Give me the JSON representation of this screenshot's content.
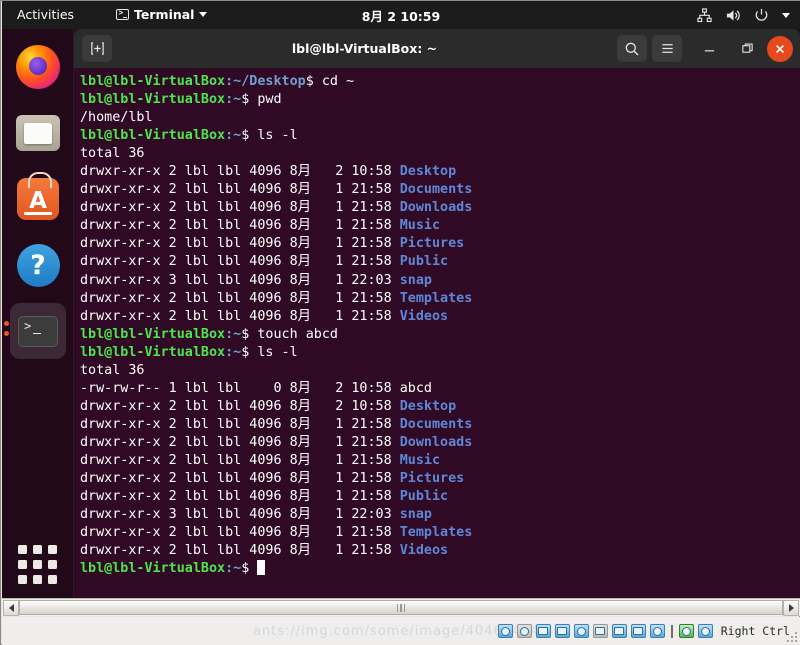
{
  "top_bar": {
    "activities": "Activities",
    "app_name": "Terminal",
    "clock": "8月 2 10:59",
    "icons": [
      "network-icon",
      "volume-icon",
      "power-icon",
      "chevron-down-icon"
    ]
  },
  "dock": {
    "items": [
      {
        "name": "firefox",
        "label": "Firefox"
      },
      {
        "name": "files",
        "label": "Files"
      },
      {
        "name": "ubuntu-software",
        "label": "Ubuntu Software",
        "glyph": "A"
      },
      {
        "name": "help",
        "label": "Help",
        "glyph": "?"
      },
      {
        "name": "terminal",
        "label": "Terminal",
        "running": true
      }
    ],
    "show_applications": "Show Applications"
  },
  "terminal": {
    "title": "lbl@lbl-VirtualBox: ~",
    "new_tab_label": "+",
    "search_label": "Search",
    "menu_label": "Menu",
    "minimize_label": "Minimize",
    "maximize_label": "Restore",
    "close_label": "Close",
    "prompt_user": "lbl@lbl-VirtualBox",
    "lines": [
      {
        "type": "prompt",
        "host": "lbl@lbl-VirtualBox",
        "path": ":~/Desktop",
        "sym": "$ ",
        "cmd": "cd ~"
      },
      {
        "type": "prompt",
        "host": "lbl@lbl-VirtualBox",
        "path": ":~",
        "sym": "$ ",
        "cmd": "pwd"
      },
      {
        "type": "out",
        "text": "/home/lbl"
      },
      {
        "type": "prompt",
        "host": "lbl@lbl-VirtualBox",
        "path": ":~",
        "sym": "$ ",
        "cmd": "ls -l"
      },
      {
        "type": "out",
        "text": "total 36"
      },
      {
        "type": "ls",
        "perm": "drwxr-xr-x",
        "links": "2",
        "owner": "lbl",
        "group": "lbl",
        "size": "4096",
        "month": "8月",
        "day": "2",
        "time": "10:58",
        "name": "Desktop",
        "dir": true
      },
      {
        "type": "ls",
        "perm": "drwxr-xr-x",
        "links": "2",
        "owner": "lbl",
        "group": "lbl",
        "size": "4096",
        "month": "8月",
        "day": "1",
        "time": "21:58",
        "name": "Documents",
        "dir": true
      },
      {
        "type": "ls",
        "perm": "drwxr-xr-x",
        "links": "2",
        "owner": "lbl",
        "group": "lbl",
        "size": "4096",
        "month": "8月",
        "day": "1",
        "time": "21:58",
        "name": "Downloads",
        "dir": true
      },
      {
        "type": "ls",
        "perm": "drwxr-xr-x",
        "links": "2",
        "owner": "lbl",
        "group": "lbl",
        "size": "4096",
        "month": "8月",
        "day": "1",
        "time": "21:58",
        "name": "Music",
        "dir": true
      },
      {
        "type": "ls",
        "perm": "drwxr-xr-x",
        "links": "2",
        "owner": "lbl",
        "group": "lbl",
        "size": "4096",
        "month": "8月",
        "day": "1",
        "time": "21:58",
        "name": "Pictures",
        "dir": true
      },
      {
        "type": "ls",
        "perm": "drwxr-xr-x",
        "links": "2",
        "owner": "lbl",
        "group": "lbl",
        "size": "4096",
        "month": "8月",
        "day": "1",
        "time": "21:58",
        "name": "Public",
        "dir": true
      },
      {
        "type": "ls",
        "perm": "drwxr-xr-x",
        "links": "3",
        "owner": "lbl",
        "group": "lbl",
        "size": "4096",
        "month": "8月",
        "day": "1",
        "time": "22:03",
        "name": "snap",
        "dir": true
      },
      {
        "type": "ls",
        "perm": "drwxr-xr-x",
        "links": "2",
        "owner": "lbl",
        "group": "lbl",
        "size": "4096",
        "month": "8月",
        "day": "1",
        "time": "21:58",
        "name": "Templates",
        "dir": true
      },
      {
        "type": "ls",
        "perm": "drwxr-xr-x",
        "links": "2",
        "owner": "lbl",
        "group": "lbl",
        "size": "4096",
        "month": "8月",
        "day": "1",
        "time": "21:58",
        "name": "Videos",
        "dir": true
      },
      {
        "type": "prompt",
        "host": "lbl@lbl-VirtualBox",
        "path": ":~",
        "sym": "$ ",
        "cmd": "touch abcd"
      },
      {
        "type": "prompt",
        "host": "lbl@lbl-VirtualBox",
        "path": ":~",
        "sym": "$ ",
        "cmd": "ls -l"
      },
      {
        "type": "out",
        "text": "total 36"
      },
      {
        "type": "ls",
        "perm": "-rw-rw-r--",
        "links": "1",
        "owner": "lbl",
        "group": "lbl",
        "size": "0",
        "month": "8月",
        "day": "2",
        "time": "10:58",
        "name": "abcd",
        "dir": false
      },
      {
        "type": "ls",
        "perm": "drwxr-xr-x",
        "links": "2",
        "owner": "lbl",
        "group": "lbl",
        "size": "4096",
        "month": "8月",
        "day": "2",
        "time": "10:58",
        "name": "Desktop",
        "dir": true
      },
      {
        "type": "ls",
        "perm": "drwxr-xr-x",
        "links": "2",
        "owner": "lbl",
        "group": "lbl",
        "size": "4096",
        "month": "8月",
        "day": "1",
        "time": "21:58",
        "name": "Documents",
        "dir": true
      },
      {
        "type": "ls",
        "perm": "drwxr-xr-x",
        "links": "2",
        "owner": "lbl",
        "group": "lbl",
        "size": "4096",
        "month": "8月",
        "day": "1",
        "time": "21:58",
        "name": "Downloads",
        "dir": true
      },
      {
        "type": "ls",
        "perm": "drwxr-xr-x",
        "links": "2",
        "owner": "lbl",
        "group": "lbl",
        "size": "4096",
        "month": "8月",
        "day": "1",
        "time": "21:58",
        "name": "Music",
        "dir": true
      },
      {
        "type": "ls",
        "perm": "drwxr-xr-x",
        "links": "2",
        "owner": "lbl",
        "group": "lbl",
        "size": "4096",
        "month": "8月",
        "day": "1",
        "time": "21:58",
        "name": "Pictures",
        "dir": true
      },
      {
        "type": "ls",
        "perm": "drwxr-xr-x",
        "links": "2",
        "owner": "lbl",
        "group": "lbl",
        "size": "4096",
        "month": "8月",
        "day": "1",
        "time": "21:58",
        "name": "Public",
        "dir": true
      },
      {
        "type": "ls",
        "perm": "drwxr-xr-x",
        "links": "3",
        "owner": "lbl",
        "group": "lbl",
        "size": "4096",
        "month": "8月",
        "day": "1",
        "time": "22:03",
        "name": "snap",
        "dir": true
      },
      {
        "type": "ls",
        "perm": "drwxr-xr-x",
        "links": "2",
        "owner": "lbl",
        "group": "lbl",
        "size": "4096",
        "month": "8月",
        "day": "1",
        "time": "21:58",
        "name": "Templates",
        "dir": true
      },
      {
        "type": "ls",
        "perm": "drwxr-xr-x",
        "links": "2",
        "owner": "lbl",
        "group": "lbl",
        "size": "4096",
        "month": "8月",
        "day": "1",
        "time": "21:58",
        "name": "Videos",
        "dir": true
      },
      {
        "type": "cursor",
        "host": "lbl@lbl-VirtualBox",
        "path": ":~",
        "sym": "$ "
      }
    ]
  },
  "vbox": {
    "host_key": "Right Ctrl",
    "watermark": "ants://img.com/some/image/404634242",
    "status_icons": [
      "harddisk-icon",
      "cd-icon",
      "network-icon",
      "shared-folder-icon",
      "mouse-icon",
      "display-icon",
      "usb-icon",
      "capture-icon",
      "video-icon",
      "globe-icon",
      "download-icon"
    ]
  },
  "colors": {
    "terminal_bg": "#300a24",
    "prompt_green": "#4ee44e",
    "prompt_blue": "#729fcf",
    "dir_blue": "#5f87d7",
    "close_orange": "#e7491e",
    "topbar_bg": "#1c1c1c",
    "titlebar_bg": "#2b2b2b"
  }
}
